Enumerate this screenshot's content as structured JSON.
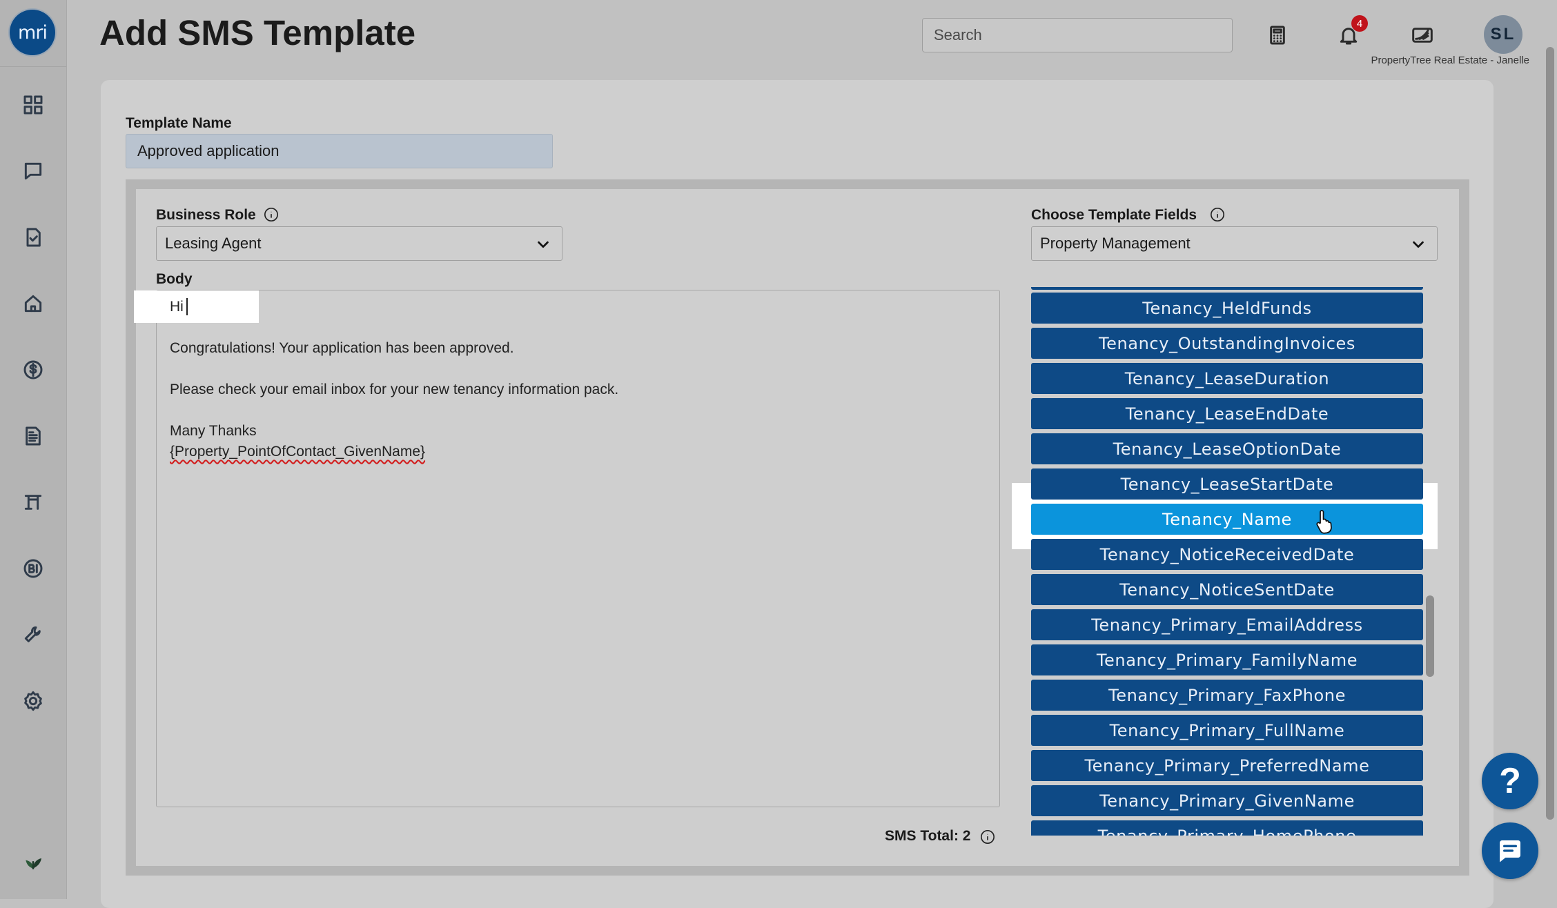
{
  "app": {
    "logo_text": "mri"
  },
  "header": {
    "title": "Add SMS Template",
    "search_placeholder": "Search",
    "notification_count": "4",
    "avatar_initials": "SL",
    "account_label": "PropertyTree Real Estate - Janelle"
  },
  "sidebar": {
    "icons": [
      "dashboard-icon",
      "messages-icon",
      "tasks-icon",
      "property-icon",
      "financials-icon",
      "reports-icon",
      "documents-icon",
      "bi-icon",
      "tools-icon",
      "settings-icon",
      "leaf-icon"
    ]
  },
  "form": {
    "template_name_label": "Template Name",
    "template_name_value": "Approved application",
    "business_role_label": "Business Role",
    "business_role_value": "Leasing Agent",
    "template_fields_label": "Choose Template Fields",
    "template_fields_value": "Property Management",
    "body_label": "Body",
    "body_lines": [
      "Hi",
      "Congratulations! Your application has been approved.",
      "Please check your email inbox for your new tenancy information pack.",
      "Many Thanks",
      "{Property_PointOfContact_GivenName}"
    ],
    "sms_total": "SMS Total: 2"
  },
  "template_fields": [
    "Tenancy_HeldFunds",
    "Tenancy_OutstandingInvoices",
    "Tenancy_LeaseDuration",
    "Tenancy_LeaseEndDate",
    "Tenancy_LeaseOptionDate",
    "Tenancy_LeaseStartDate",
    "Tenancy_Name",
    "Tenancy_NoticeReceivedDate",
    "Tenancy_NoticeSentDate",
    "Tenancy_Primary_EmailAddress",
    "Tenancy_Primary_FamilyName",
    "Tenancy_Primary_FaxPhone",
    "Tenancy_Primary_FullName",
    "Tenancy_Primary_PreferredName",
    "Tenancy_Primary_GivenName",
    "Tenancy_Primary_HomePhone"
  ],
  "hovered_field": "Tenancy_Name",
  "help_label": "?",
  "colors": {
    "field_button": "#0e4a86",
    "field_button_hover": "#0b94dc",
    "badge": "#c0131b",
    "brand": "#0b4a87"
  }
}
